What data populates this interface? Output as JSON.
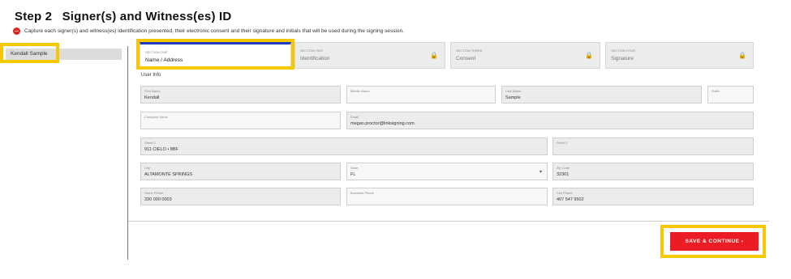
{
  "header": {
    "step": "Step 2",
    "title": "Signer(s) and Witness(es) ID",
    "info_icon": "minus-circle-icon",
    "info_text": "Capture each signer(s) and witness(es) identification presented, their electronic consent and their signature and initials that will be used during the signing session."
  },
  "signers": [
    {
      "name": "Kendall Sample"
    }
  ],
  "sections": [
    {
      "label": "SECTION ONE",
      "value": "Name / Address",
      "locked": false
    },
    {
      "label": "SECTION TWO",
      "value": "Identification",
      "locked": true
    },
    {
      "label": "SECTION THREE",
      "value": "Consent",
      "locked": true
    },
    {
      "label": "SECTION FOUR",
      "value": "Signature",
      "locked": true
    }
  ],
  "lock_icon": "lock-icon",
  "user_info_heading": "User Info",
  "fields": {
    "first_name": {
      "label": "First Name",
      "value": "Kendall"
    },
    "middle_name": {
      "label": "Middle Name",
      "value": ""
    },
    "last_name": {
      "label": "Last Name",
      "value": "Sample"
    },
    "suffix": {
      "label": "Suffix",
      "value": ""
    },
    "company_name": {
      "label": "Company Name",
      "value": ""
    },
    "email": {
      "label": "Email",
      "value": "megan.proctor@linksigning.com"
    },
    "street1": {
      "label": "Street 1",
      "value": "911 CIELO • 8BF"
    },
    "street2": {
      "label": "Street 2",
      "value": ""
    },
    "city": {
      "label": "City",
      "value": "ALTAMONTE SPRINGS"
    },
    "state": {
      "label": "State",
      "value": "FL"
    },
    "zip_code": {
      "label": "Zip Code",
      "value": "32301"
    },
    "home_phone": {
      "label": "Home Phone",
      "value": "330 000 0003"
    },
    "work_phone": {
      "label": "Business Phone",
      "value": ""
    },
    "cell_phone": {
      "label": "Cell Phone",
      "value": "407 547 9502"
    }
  },
  "save_button": "SAVE & CONTINUE ›"
}
